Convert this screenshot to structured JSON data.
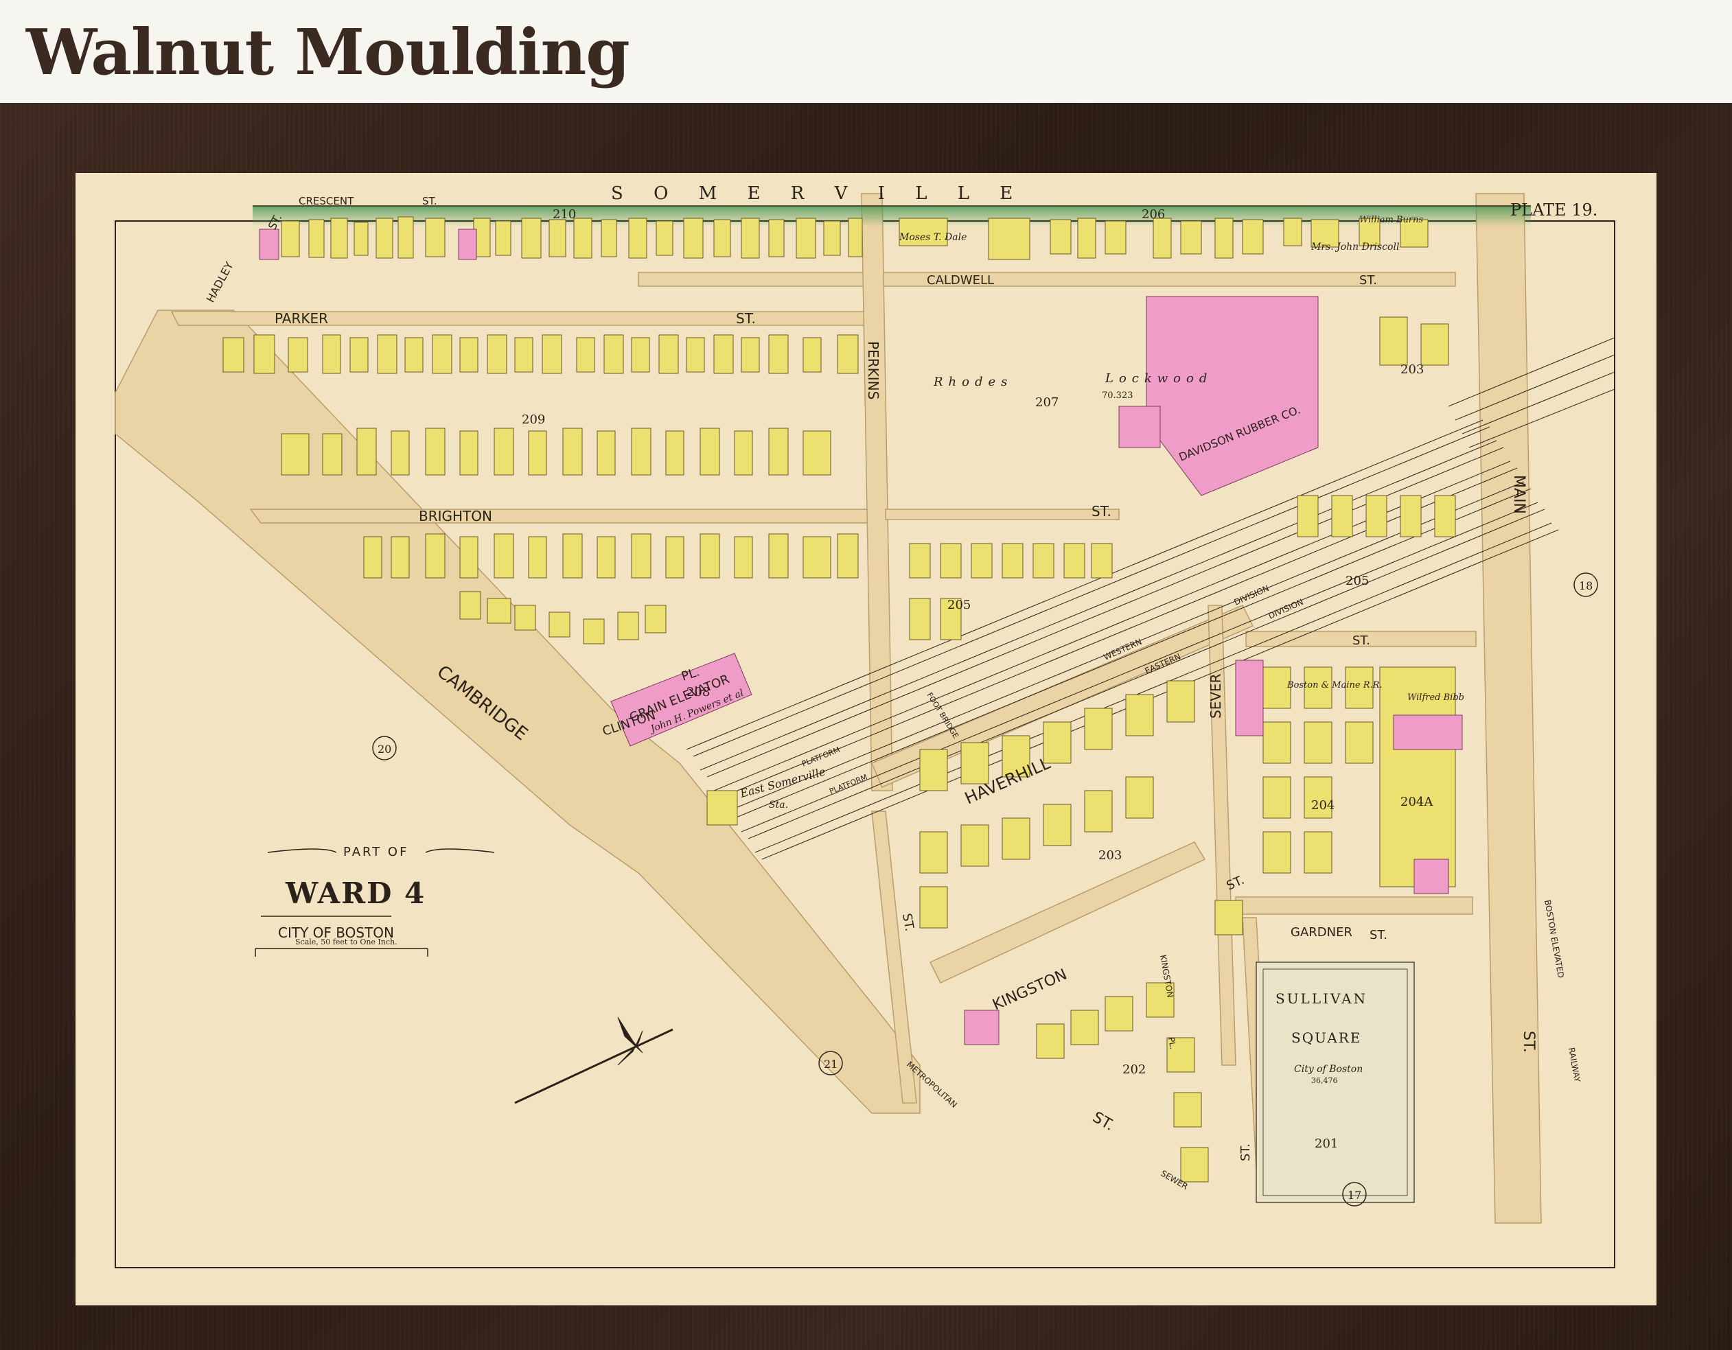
{
  "page": {
    "title": "Walnut Moulding"
  },
  "map": {
    "plate": "PLATE 19.",
    "region_label": "S O M E R V I L L E",
    "cartouche": {
      "line1": "PART OF",
      "line2": "WARD 4",
      "line3": "CITY OF BOSTON",
      "scale": "Scale, 50 feet to One Inch."
    },
    "streets": {
      "crescent": "CRESCENT",
      "crescent_st": "ST.",
      "hadley": "HADLEY",
      "hadley_st": "ST.",
      "caldwell": "CALDWELL",
      "caldwell_st": "ST.",
      "parker": "PARKER",
      "parker_st": "ST.",
      "perkins": "PERKINS",
      "brighton": "BRIGHTON",
      "rhodes_st": "ST.",
      "cambridge": "CAMBRIDGE",
      "clinton": "CLINTON",
      "clinton_pl": "PL.",
      "haverhill": "HAVERHILL",
      "haverhill_st": "ST.",
      "kingston": "KINGSTON",
      "kingston_st": "ST.",
      "kingston_pl": "KINGSTON",
      "kingston_pl_pl": "PL.",
      "sever": "SEVER",
      "sever_st": "ST.",
      "gardner": "GARDNER",
      "gardner_st": "ST.",
      "main": "MAIN",
      "main_st": "ST.",
      "metropolitan": "METROPOLITAN",
      "cambridge_st": "ST.",
      "lower_st": "ST.",
      "middle_st": "ST.",
      "boston_elevated": "BOSTON ELEVATED",
      "railway": "RAILWAY",
      "sewer": "SEWER"
    },
    "labels": {
      "rhodes": "Rhodes",
      "lockwood": "Lockwood",
      "rhodes_area": "70.323",
      "davidson": "DAVIDSON RUBBER CO.",
      "grain": "GRAIN ELEVATOR",
      "grain_owner": "John H. Powers et al",
      "east_somerville": "East Somerville",
      "sta": "Sta.",
      "platform1": "PLATFORM",
      "platform2": "PLATFORM",
      "foot_bridge": "FOOT BRIDGE",
      "western": "WESTERN",
      "eastern": "EASTERN",
      "division1": "DIVISION",
      "division2": "DIVISION",
      "boston_maine": "Boston & Maine R.R.",
      "sullivan1": "SULLIVAN",
      "sullivan2": "SQUARE",
      "sullivan_city": "City of Boston",
      "sullivan_area": "36,476",
      "moses": "Moses T. Dale",
      "driscoll": "Mrs. John Driscoll",
      "william_burns": "William Burns",
      "wilfred": "Wilfred Bibb"
    },
    "block_numbers": {
      "b210": "210",
      "b206": "206",
      "b209": "209",
      "b207": "207",
      "b203a": "203",
      "b205a": "205",
      "b205b": "205",
      "b208": "208",
      "b203b": "203",
      "b204": "204",
      "b204a": "204A",
      "b202": "202",
      "b201": "201"
    },
    "plate_refs": {
      "p18": "18",
      "p20": "20",
      "p21": "21",
      "p17": "17"
    }
  }
}
